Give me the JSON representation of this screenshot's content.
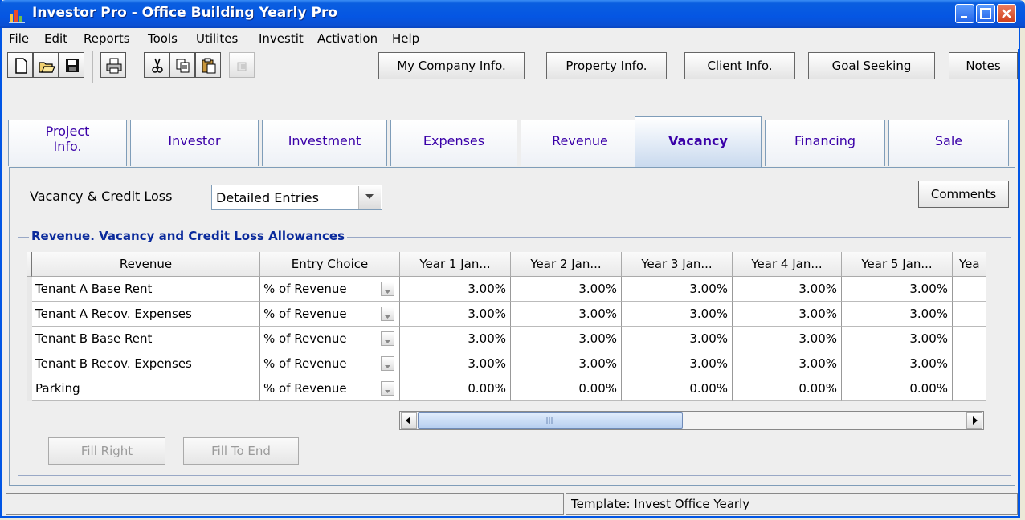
{
  "window": {
    "title": "Investor Pro  - Office Building Yearly Pro"
  },
  "menu": {
    "items": [
      "File",
      "Edit",
      "Reports",
      "Tools",
      "Utilites",
      "Investit",
      "Activation",
      "Help"
    ]
  },
  "toolbar": {
    "icons": [
      "new-document-icon",
      "open-folder-icon",
      "save-disk-icon",
      "print-icon",
      "cut-icon",
      "copy-icon",
      "paste-icon",
      "disabled-tool-icon"
    ],
    "buttons": [
      "My Company Info.",
      "Property Info.",
      "Client Info.",
      "Goal Seeking",
      "Notes"
    ]
  },
  "tabs": {
    "items": [
      {
        "label_line1": "Project",
        "label_line2": "Info."
      },
      {
        "label_line1": "Investor",
        "label_line2": ""
      },
      {
        "label_line1": "Investment",
        "label_line2": ""
      },
      {
        "label_line1": "Expenses",
        "label_line2": ""
      },
      {
        "label_line1": "Revenue",
        "label_line2": ""
      },
      {
        "label_line1": "Vacancy",
        "label_line2": ""
      },
      {
        "label_line1": "Financing",
        "label_line2": ""
      },
      {
        "label_line1": "Sale",
        "label_line2": ""
      }
    ],
    "active": "Vacancy"
  },
  "vacancy": {
    "label": "Vacancy & Credit Loss",
    "selected": "Detailed Entries",
    "comments_button": "Comments",
    "group_title": "Revenue. Vacancy and Credit Loss Allowances"
  },
  "table": {
    "headers": [
      "Revenue",
      "Entry Choice",
      "Year 1 Jan...",
      "Year 2 Jan...",
      "Year 3 Jan...",
      "Year 4 Jan...",
      "Year 5 Jan...",
      "Yea"
    ],
    "rows": [
      {
        "name": "Tenant A Base Rent",
        "choice": "% of Revenue",
        "values": [
          "3.00%",
          "3.00%",
          "3.00%",
          "3.00%",
          "3.00%"
        ]
      },
      {
        "name": "Tenant A Recov. Expenses",
        "choice": "% of Revenue",
        "values": [
          "3.00%",
          "3.00%",
          "3.00%",
          "3.00%",
          "3.00%"
        ]
      },
      {
        "name": "Tenant B Base Rent",
        "choice": "% of Revenue",
        "values": [
          "3.00%",
          "3.00%",
          "3.00%",
          "3.00%",
          "3.00%"
        ]
      },
      {
        "name": "Tenant B Recov. Expenses",
        "choice": "% of Revenue",
        "values": [
          "3.00%",
          "3.00%",
          "3.00%",
          "3.00%",
          "3.00%"
        ]
      },
      {
        "name": "Parking",
        "choice": "% of Revenue",
        "values": [
          "0.00%",
          "0.00%",
          "0.00%",
          "0.00%",
          "0.00%"
        ]
      }
    ]
  },
  "actions": {
    "fill_right": "Fill Right",
    "fill_to_end": "Fill To End"
  },
  "status": {
    "left": "",
    "template": "Template: Invest Office Yearly"
  },
  "colors": {
    "title_bar": "#0556e3",
    "tab_text": "#3a00a8",
    "group_title": "#0a2a9c"
  }
}
